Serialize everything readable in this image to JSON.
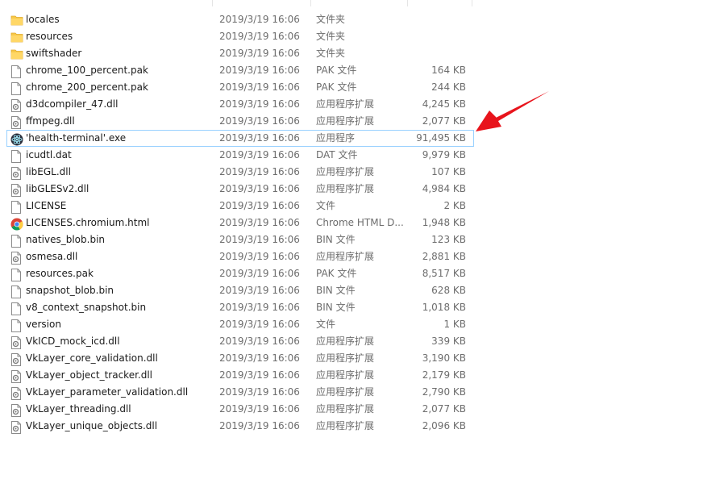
{
  "arrow_color": "#e8141c",
  "files": [
    {
      "name": "locales",
      "date": "2019/3/19 16:06",
      "type": "文件夹",
      "size": "",
      "icon": "folder-icon"
    },
    {
      "name": "resources",
      "date": "2019/3/19 16:06",
      "type": "文件夹",
      "size": "",
      "icon": "folder-icon"
    },
    {
      "name": "swiftshader",
      "date": "2019/3/19 16:06",
      "type": "文件夹",
      "size": "",
      "icon": "folder-icon"
    },
    {
      "name": "chrome_100_percent.pak",
      "date": "2019/3/19 16:06",
      "type": "PAK 文件",
      "size": "164 KB",
      "icon": "file-icon"
    },
    {
      "name": "chrome_200_percent.pak",
      "date": "2019/3/19 16:06",
      "type": "PAK 文件",
      "size": "244 KB",
      "icon": "file-icon"
    },
    {
      "name": "d3dcompiler_47.dll",
      "date": "2019/3/19 16:06",
      "type": "应用程序扩展",
      "size": "4,245 KB",
      "icon": "dll-icon"
    },
    {
      "name": "ffmpeg.dll",
      "date": "2019/3/19 16:06",
      "type": "应用程序扩展",
      "size": "2,077 KB",
      "icon": "dll-icon"
    },
    {
      "name": "'health-terminal'.exe",
      "date": "2019/3/19 16:06",
      "type": "应用程序",
      "size": "91,495 KB",
      "icon": "electron-app-icon",
      "selected": true
    },
    {
      "name": "icudtl.dat",
      "date": "2019/3/19 16:06",
      "type": "DAT 文件",
      "size": "9,979 KB",
      "icon": "file-icon"
    },
    {
      "name": "libEGL.dll",
      "date": "2019/3/19 16:06",
      "type": "应用程序扩展",
      "size": "107 KB",
      "icon": "dll-icon"
    },
    {
      "name": "libGLESv2.dll",
      "date": "2019/3/19 16:06",
      "type": "应用程序扩展",
      "size": "4,984 KB",
      "icon": "dll-icon"
    },
    {
      "name": "LICENSE",
      "date": "2019/3/19 16:06",
      "type": "文件",
      "size": "2 KB",
      "icon": "file-icon"
    },
    {
      "name": "LICENSES.chromium.html",
      "date": "2019/3/19 16:06",
      "type": "Chrome HTML D...",
      "size": "1,948 KB",
      "icon": "chrome-icon"
    },
    {
      "name": "natives_blob.bin",
      "date": "2019/3/19 16:06",
      "type": "BIN 文件",
      "size": "123 KB",
      "icon": "file-icon"
    },
    {
      "name": "osmesa.dll",
      "date": "2019/3/19 16:06",
      "type": "应用程序扩展",
      "size": "2,881 KB",
      "icon": "dll-icon"
    },
    {
      "name": "resources.pak",
      "date": "2019/3/19 16:06",
      "type": "PAK 文件",
      "size": "8,517 KB",
      "icon": "file-icon"
    },
    {
      "name": "snapshot_blob.bin",
      "date": "2019/3/19 16:06",
      "type": "BIN 文件",
      "size": "628 KB",
      "icon": "file-icon"
    },
    {
      "name": "v8_context_snapshot.bin",
      "date": "2019/3/19 16:06",
      "type": "BIN 文件",
      "size": "1,018 KB",
      "icon": "file-icon"
    },
    {
      "name": "version",
      "date": "2019/3/19 16:06",
      "type": "文件",
      "size": "1 KB",
      "icon": "file-icon"
    },
    {
      "name": "VkICD_mock_icd.dll",
      "date": "2019/3/19 16:06",
      "type": "应用程序扩展",
      "size": "339 KB",
      "icon": "dll-icon"
    },
    {
      "name": "VkLayer_core_validation.dll",
      "date": "2019/3/19 16:06",
      "type": "应用程序扩展",
      "size": "3,190 KB",
      "icon": "dll-icon"
    },
    {
      "name": "VkLayer_object_tracker.dll",
      "date": "2019/3/19 16:06",
      "type": "应用程序扩展",
      "size": "2,179 KB",
      "icon": "dll-icon"
    },
    {
      "name": "VkLayer_parameter_validation.dll",
      "date": "2019/3/19 16:06",
      "type": "应用程序扩展",
      "size": "2,790 KB",
      "icon": "dll-icon"
    },
    {
      "name": "VkLayer_threading.dll",
      "date": "2019/3/19 16:06",
      "type": "应用程序扩展",
      "size": "2,077 KB",
      "icon": "dll-icon"
    },
    {
      "name": "VkLayer_unique_objects.dll",
      "date": "2019/3/19 16:06",
      "type": "应用程序扩展",
      "size": "2,096 KB",
      "icon": "dll-icon"
    }
  ]
}
